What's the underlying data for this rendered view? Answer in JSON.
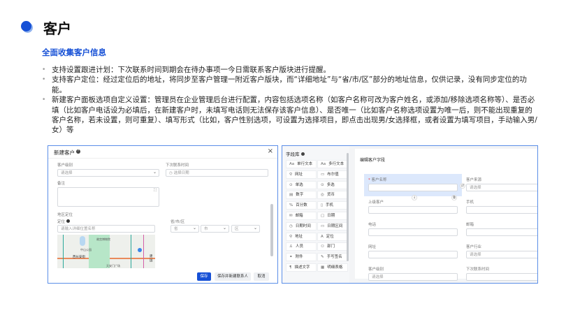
{
  "title": "客户",
  "subtitle": "全面收集客户信息",
  "bullets": [
    "支持设置跟进计划：下次联系时间到期会在待办事项一今日需联系客户版块进行提醒。",
    "支持客户定位：经过定位后的地址，将同步至客户管理一附近客户版块，而“详细地址”与“省/市/区”部分的地址信息，仅供记录，没有同步定位的功能。",
    "新建客户面板选项自定义设置：管理员在企业管理后台进行配置，内容包括选项名称（如客户名称可改为客户姓名，或添加/移除选项名称等）、是否必填（比如客户电话设为必填后，在新建客户时，未填写电话则无法保存该客户信息）、是否唯一（比如客户名称选项设置为唯一后，则不能出现重复的客户名称，若未设置，则可重复）、填写形式（比如，客户性别选项，可设置为选择项目，即点击出现男/女选择框，或者设置为填写项目，手动输入男/女）等"
  ],
  "left_modal": {
    "title": "新建客户",
    "level_label": "客户级别",
    "level_placeholder": "请选择",
    "next_contact_label": "下次联系时间",
    "next_contact_placeholder": "选择日期",
    "remark_label": "备注",
    "region_label": "地区定位",
    "locate_label": "定位",
    "locate_placeholder": "请输入详细位置名称",
    "pcd_label": "省/市/区",
    "province": "省",
    "city": "市",
    "district": "区",
    "map_labels": [
      "西长安街",
      "中山公园",
      "故宫博物院",
      "天安门广场",
      "建国"
    ],
    "save": "保存",
    "save_and_new_contact": "保存并新建联系人",
    "cancel": "取消"
  },
  "right_panel": {
    "library_title": "字段库",
    "fields": [
      {
        "icon": "Aa",
        "label": "单行文本"
      },
      {
        "icon": "Aa",
        "label": "多行文本"
      },
      {
        "icon": "⚲",
        "label": "网址"
      },
      {
        "icon": "▭",
        "label": "布尔值"
      },
      {
        "icon": "⊙",
        "label": "单选"
      },
      {
        "icon": "⊙",
        "label": "多选"
      },
      {
        "icon": "▤",
        "label": "数字"
      },
      {
        "icon": "◎",
        "label": "货币"
      },
      {
        "icon": "%",
        "label": "百分数"
      },
      {
        "icon": "▯",
        "label": "手机"
      },
      {
        "icon": "✉",
        "label": "邮箱"
      },
      {
        "icon": "▢",
        "label": "日期"
      },
      {
        "icon": "◷",
        "label": "日期时间"
      },
      {
        "icon": "▭",
        "label": "日期区间"
      },
      {
        "icon": "⚲",
        "label": "地址"
      },
      {
        "icon": "A",
        "label": "定位"
      },
      {
        "icon": "♙",
        "label": "人员"
      },
      {
        "icon": "⚇",
        "label": "部门"
      },
      {
        "icon": "⚭",
        "label": "附件"
      },
      {
        "icon": "✎",
        "label": "手写签名"
      },
      {
        "icon": "¶",
        "label": "描述文字"
      },
      {
        "icon": "▦",
        "label": "明细表格"
      }
    ],
    "editor_title": "编辑客户字段",
    "form": [
      {
        "label": "客户名称",
        "required": true,
        "placeholder": ""
      },
      {
        "label": "客户来源",
        "placeholder": "请选择"
      },
      {
        "label": "上级客户",
        "placeholder": ""
      },
      {
        "label": "手机",
        "placeholder": ""
      },
      {
        "label": "电话",
        "placeholder": ""
      },
      {
        "label": "邮箱",
        "placeholder": ""
      },
      {
        "label": "网址",
        "placeholder": ""
      },
      {
        "label": "客户行业",
        "placeholder": "请选择"
      },
      {
        "label": "客户级别",
        "placeholder": "请选择"
      },
      {
        "label": "下次联系时间",
        "placeholder": ""
      }
    ]
  },
  "colors": {
    "accent": "#1650d6",
    "border": "#5b8ee8"
  }
}
